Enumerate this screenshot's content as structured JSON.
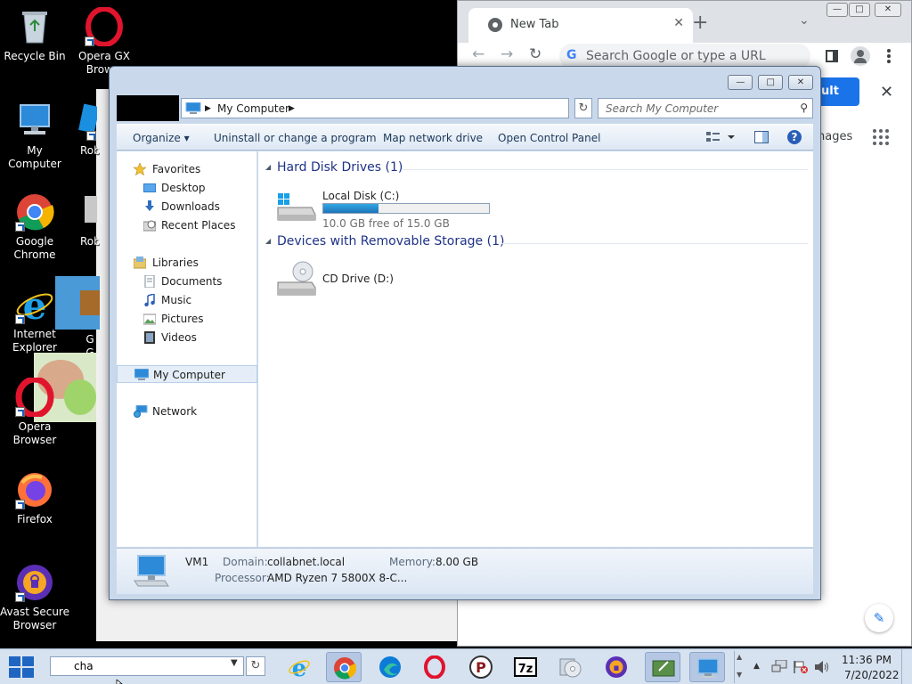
{
  "desktop": {
    "icons": [
      {
        "label": "Recycle Bin"
      },
      {
        "label": "Opera GX Brow..."
      },
      {
        "label": "My Computer"
      },
      {
        "label": "Roblo"
      },
      {
        "label": "Google Chrome"
      },
      {
        "label": "Roblo"
      },
      {
        "label": "Internet Explorer"
      },
      {
        "label": "G G"
      },
      {
        "label": "Opera Browser"
      },
      {
        "label": "Firefox"
      },
      {
        "label": "Avast Secure Browser"
      }
    ]
  },
  "chrome": {
    "tab_title": "New Tab",
    "tab_close": "✕",
    "new_tab": "+",
    "tab_search": "⌄",
    "omnibox_placeholder": "Search Google or type a URL",
    "omnibox_g": "G",
    "banner_button": "ult",
    "banner_close": "✕",
    "images_link": "nages",
    "edit_icon": "✎",
    "back": "←",
    "forward": "→",
    "reload": "↻"
  },
  "explorer": {
    "address": {
      "location": "My Computer"
    },
    "search_placeholder": "Search My Computer",
    "commands": {
      "organize": "Organize ▾",
      "uninstall": "Uninstall or change a program",
      "map_drive": "Map network drive",
      "control_panel": "Open Control Panel"
    },
    "nav": {
      "favorites": "Favorites",
      "desktop": "Desktop",
      "downloads": "Downloads",
      "recent": "Recent Places",
      "libraries": "Libraries",
      "documents": "Documents",
      "music": "Music",
      "pictures": "Pictures",
      "videos": "Videos",
      "my_computer": "My Computer",
      "network": "Network"
    },
    "groups": {
      "hdd": "Hard Disk Drives (1)",
      "removable": "Devices with Removable Storage (1)"
    },
    "drives": {
      "c_name": "Local Disk (C:)",
      "c_free": "10.0 GB free of 15.0 GB",
      "c_used_fraction": 0.333,
      "d_name": "CD Drive (D:)"
    },
    "details": {
      "name": "VM1",
      "domain_label": "Domain:",
      "domain_value": "collabnet.local",
      "memory_label": "Memory:",
      "memory_value": "8.00 GB",
      "processor_label": "Processor:",
      "processor_value": "AMD Ryzen 7 5800X 8-C..."
    }
  },
  "taskbar": {
    "input_value": "cha",
    "clock_time": "11:36 PM",
    "clock_date": "7/20/2022"
  },
  "colors": {
    "accent": "#1a73e8",
    "explorer_frame": "#c9d8ea",
    "group_header": "#1e3287",
    "drive_fill": "#1c74b8"
  }
}
